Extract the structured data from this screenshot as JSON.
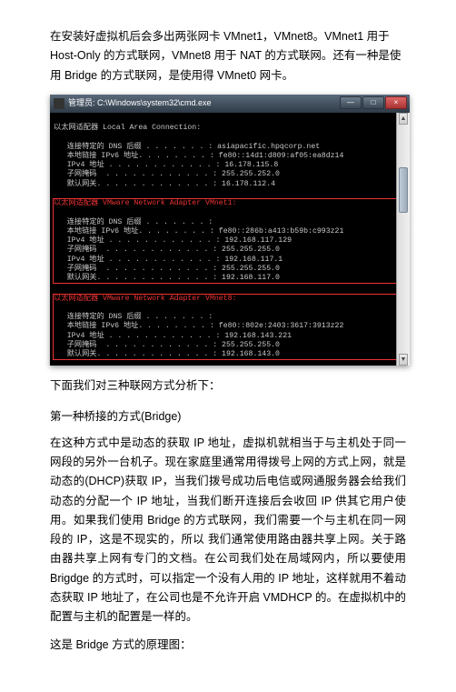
{
  "intro": "在安装好虚拟机后会多出两张网卡 VMnet1，VMnet8。VMnet1 用于 Host-Only 的方式联网，VMnet8 用于 NAT 的方式联网。还有一种是使用 Bridge 的方式联网，是使用得 VMnet0 网卡。",
  "window": {
    "title": "管理员: C:\\Windows\\system32\\cmd.exe",
    "controls": {
      "min": "—",
      "max": "□",
      "close": "×"
    }
  },
  "term": {
    "block0": {
      "adapter": "以太网适配器 Local Area Connection:",
      "lines": [
        "   连接特定的 DNS 后缀 . . . . . . . : asiapacific.hpqcorp.net",
        "   本地链接 IPv6 地址. . . . . . . . : fe80::14d1:d809:af05:ea8dz14",
        "   IPv4 地址 . . . . . . . . . . . . : 16.178.115.8",
        "   子网掩码  . . . . . . . . . . . . : 255.255.252.0",
        "   默认网关. . . . . . . . . . . . . : 16.178.112.4"
      ]
    },
    "block1": {
      "adapter": "以太网适配器 VMware Network Adapter VMnet1:",
      "lines": [
        "   连接特定的 DNS 后缀 . . . . . . . :",
        "   本地链接 IPv6 地址. . . . . . . . : fe80::286b:a413:b59b:c993z21",
        "   IPv4 地址 . . . . . . . . . . . . : 192.168.117.129",
        "   子网掩码  . . . . . . . . . . . . : 255.255.255.0",
        "   IPv4 地址 . . . . . . . . . . . . : 192.168.117.1",
        "   子网掩码  . . . . . . . . . . . . : 255.255.255.0",
        "   默认网关. . . . . . . . . . . . . : 192.168.117.0"
      ]
    },
    "block2": {
      "adapter": "以太网适配器 VMware Network Adapter VMnet8:",
      "lines": [
        "   连接特定的 DNS 后缀 . . . . . . . :",
        "   本地链接 IPv6 地址. . . . . . . . : fe80::802e:2403:3617:3913z22",
        "   IPv4 地址 . . . . . . . . . . . . : 192.168.143.221",
        "   子网掩码  . . . . . . . . . . . . : 255.255.255.0",
        "   默认网关. . . . . . . . . . . . . : 192.168.143.0"
      ]
    }
  },
  "analysis_heading": "下面我们对三种联网方式分析下：",
  "method1_heading": "第一种桥接的方式(Bridge)",
  "method1_body": "在这种方式中是动态的获取 IP 地址，虚拟机就相当于与主机处于同一网段的另外一台机子。现在家庭里通常用得拨号上网的方式上网，就是动态的(DHCP)获取 IP，当我们拨号成功后电信或网通服务器会给我们动态的分配一个 IP 地址，当我们断开连接后会收回 IP 供其它用户使用。如果我们使用 Bridge 的方式联网，我们需要一个与主机在同一网段的 IP，这是不现实的，所以 我们通常使用路由器共享上网。关于路由器共享上网有专门的文档。在公司我们处在局域网内，所以要使用 Brigdge 的方式时，可以指定一个没有人用的 IP 地址，这样就用不着动态获取 IP 地址了，在公司也是不允许开启 VMDHCP 的。在虚拟机中的配置与主机的配置是一样的。",
  "bridge_image_caption": "这是 Bridge 方式的原理图："
}
